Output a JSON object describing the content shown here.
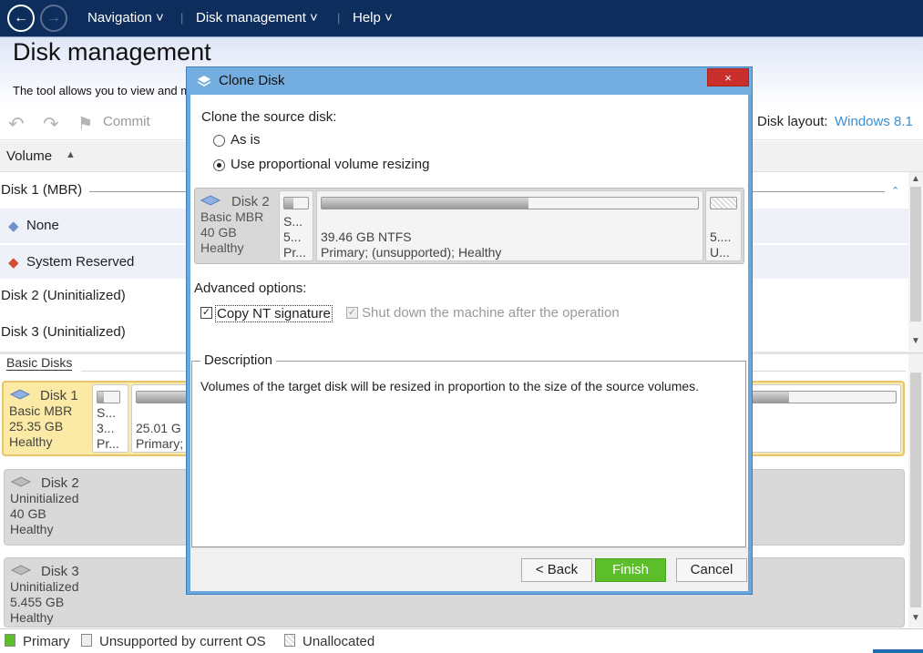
{
  "nav": {
    "items": [
      "Navigation",
      "Disk management",
      "Help"
    ]
  },
  "header": {
    "title": "Disk management",
    "subtitle": "The tool allows you to view and ma"
  },
  "toolbar": {
    "commit": "Commit",
    "disk_layout_label": "Disk layout:",
    "disk_layout_value": "Windows 8.1"
  },
  "table": {
    "column": "Volume",
    "rows": [
      {
        "label": "Disk 1 (MBR)"
      },
      {
        "label": "None"
      },
      {
        "label": "System Reserved"
      },
      {
        "label": "Disk 2 (Uninitialized)"
      },
      {
        "label": "Disk 3 (Uninitialized)"
      }
    ]
  },
  "basic_disks": {
    "label": "Basic Disks",
    "disk1": {
      "name": "Disk 1",
      "type": "Basic MBR",
      "size": "25.35 GB",
      "status": "Healthy",
      "small_vol": [
        "S...",
        "3...",
        "Pr..."
      ],
      "vol_size": "25.01 G",
      "vol_type": "Primary;"
    },
    "disk2": {
      "name": "Disk 2",
      "type": "Uninitialized",
      "size": "40 GB",
      "status": "Healthy"
    },
    "disk3": {
      "name": "Disk 3",
      "type": "Uninitialized",
      "size": "5.455 GB",
      "status": "Healthy"
    }
  },
  "legend": {
    "primary": "Primary",
    "unsupported": "Unsupported by current OS",
    "unallocated": "Unallocated",
    "colors": {
      "primary": "#5cbf2a",
      "unsupported": "#eeeeee",
      "unallocated": "#dddddd"
    }
  },
  "dialog": {
    "title": "Clone Disk",
    "close_icon": "×",
    "clone_label": "Clone the source disk:",
    "radio_as_is": "As is",
    "radio_proportional": "Use proportional volume resizing",
    "source": {
      "name": "Disk 2",
      "type": "Basic MBR",
      "size": "40 GB",
      "status": "Healthy",
      "vol_a": [
        "S...",
        "5...",
        "Pr..."
      ],
      "vol_b_size": "39.46 GB NTFS",
      "vol_b_desc": "Primary;  (unsupported); Healthy",
      "vol_c": [
        "5....",
        "U..."
      ]
    },
    "advanced_label": "Advanced options:",
    "copy_nt": "Copy NT signature",
    "shutdown": "Shut down the machine after the operation",
    "description_label": "Description",
    "description_text": "Volumes of the target disk will be resized in proportion to the size of the source volumes.",
    "buttons": {
      "back": "< Back",
      "finish": "Finish",
      "cancel": "Cancel"
    }
  }
}
